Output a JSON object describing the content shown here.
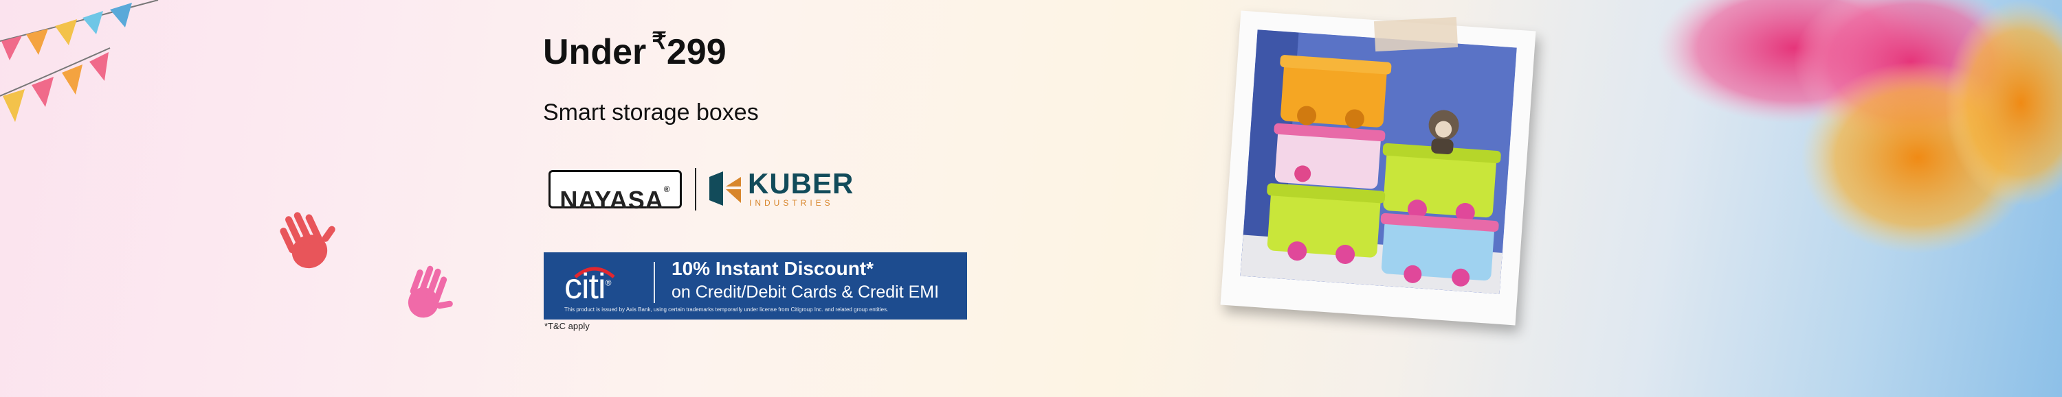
{
  "banner": {
    "headline_prefix": "Under",
    "currency_symbol": "₹",
    "price": "299",
    "subline": "Smart storage boxes",
    "brands": {
      "nayasa": "NAYASA",
      "nayasa_mark": "®",
      "kuber": "KUBER",
      "kuber_sub": "INDUSTRIES"
    },
    "offer": {
      "bank": "citi",
      "bank_mark": "®",
      "title": "10% Instant Discount*",
      "subtitle": "on Credit/Debit Cards & Credit EMI",
      "fine_print": "This product is issued by Axis Bank, using certain trademarks temporarily under license from Citigroup Inc. and related group entities."
    },
    "tnc": "*T&C apply"
  },
  "icons": [
    "bunting-flags",
    "handprint-red-icon",
    "handprint-pink-icon",
    "kuber-logo-icon",
    "citi-arc-icon",
    "storage-boxes-photo",
    "color-powder-splash"
  ],
  "colors": {
    "offer_bg": "#1d4c8f",
    "kuber_teal": "#124b5a",
    "kuber_orange": "#d8862c",
    "handprint_red": "#e8555a",
    "handprint_pink": "#f06aa8"
  }
}
